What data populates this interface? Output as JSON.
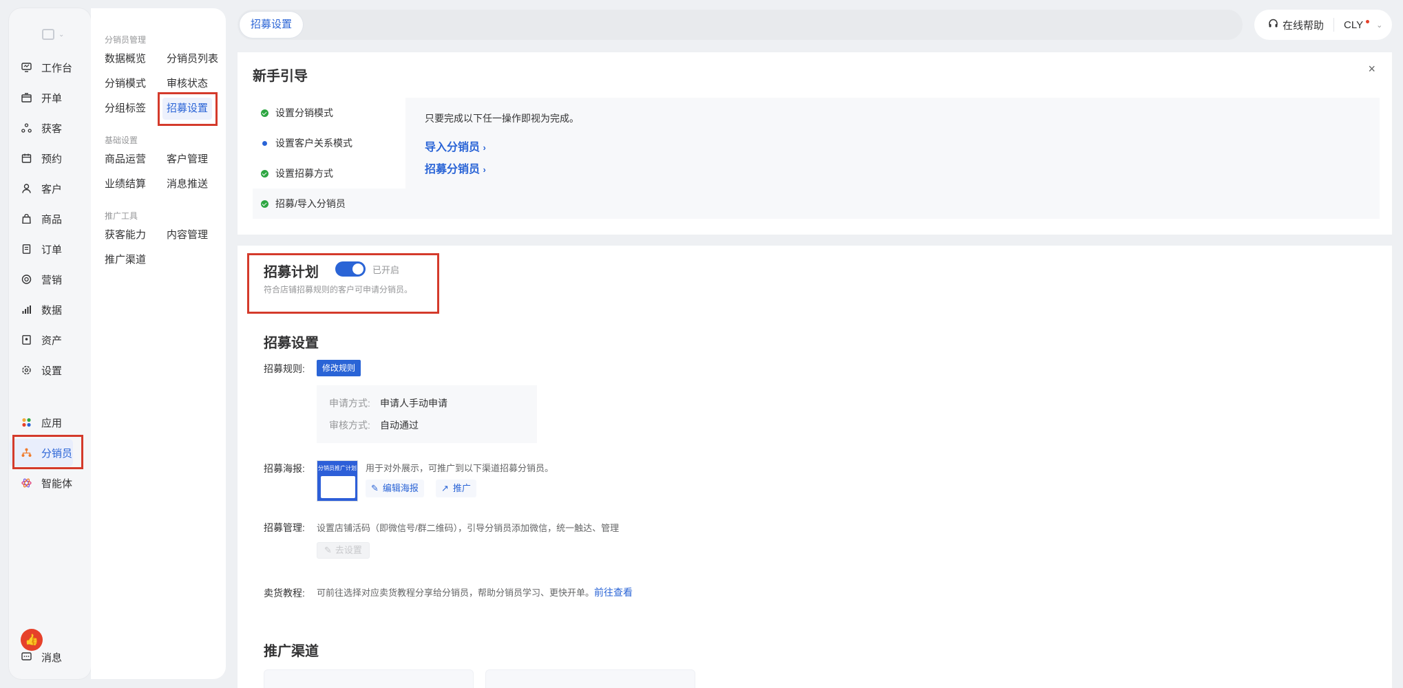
{
  "sidebar": {
    "items": [
      {
        "label": "工作台",
        "icon": "workbench-icon"
      },
      {
        "label": "开单",
        "icon": "cashier-icon"
      },
      {
        "label": "获客",
        "icon": "acquire-icon"
      },
      {
        "label": "预约",
        "icon": "calendar-icon"
      },
      {
        "label": "客户",
        "icon": "user-icon"
      },
      {
        "label": "商品",
        "icon": "bag-icon"
      },
      {
        "label": "订单",
        "icon": "order-icon"
      },
      {
        "label": "营销",
        "icon": "target-icon"
      },
      {
        "label": "数据",
        "icon": "bar-chart-icon"
      },
      {
        "label": "资产",
        "icon": "asset-icon"
      },
      {
        "label": "设置",
        "icon": "gear-icon"
      }
    ],
    "lower_items": [
      {
        "label": "应用",
        "icon": "apps-icon"
      },
      {
        "label": "分销员",
        "icon": "distributor-icon"
      },
      {
        "label": "智能体",
        "icon": "agent-icon"
      }
    ],
    "message_label": "消息"
  },
  "subnav": {
    "groups": [
      {
        "title": "分销员管理",
        "links": [
          "数据概览",
          "分销员列表",
          "分销模式",
          "审核状态",
          "分组标签",
          "招募设置"
        ]
      },
      {
        "title": "基础设置",
        "links": [
          "商品运营",
          "客户管理",
          "业绩结算",
          "消息推送"
        ]
      },
      {
        "title": "推广工具",
        "links": [
          "获客能力",
          "内容管理",
          "推广渠道"
        ]
      }
    ]
  },
  "topbar": {
    "tab": "招募设置",
    "help": "在线帮助",
    "user": "CLY"
  },
  "guide": {
    "title": "新手引导",
    "close": "×",
    "steps": [
      "设置分销模式",
      "设置客户关系模式",
      "设置招募方式",
      "招募/导入分销员"
    ],
    "tip": "只要完成以下任一操作即视为完成。",
    "links": [
      "导入分销员",
      "招募分销员"
    ]
  },
  "plan": {
    "title": "招募计划",
    "status": "已开启",
    "enabled": true,
    "desc": "符合店铺招募规则的客户可申请分销员。"
  },
  "settings": {
    "title": "招募设置",
    "rule_label": "招募规则:",
    "modify_btn": "修改规则",
    "apply_key": "申请方式:",
    "apply_val": "申请人手动申请",
    "audit_key": "审核方式:",
    "audit_val": "自动通过",
    "poster_label": "招募海报:",
    "poster_thumb_title": "分销员推广计划",
    "poster_desc": "用于对外展示，可推广到以下渠道招募分销员。",
    "edit_poster": "编辑海报",
    "promote": "推广",
    "mgmt_label": "招募管理:",
    "mgmt_desc": "设置店铺活码（即微信号/群二维码），引导分销员添加微信，统一触达、管理",
    "go_set": "去设置",
    "tutorial_label": "卖货教程:",
    "tutorial_desc": "可前往选择对应卖货教程分享给分销员，帮助分销员学习、更快开单。",
    "tutorial_link": "前往查看"
  },
  "channels": {
    "title": "推广渠道"
  },
  "colors": {
    "accent": "#2a64d6",
    "highlight_box": "#d43a2b",
    "success": "#2da641"
  }
}
